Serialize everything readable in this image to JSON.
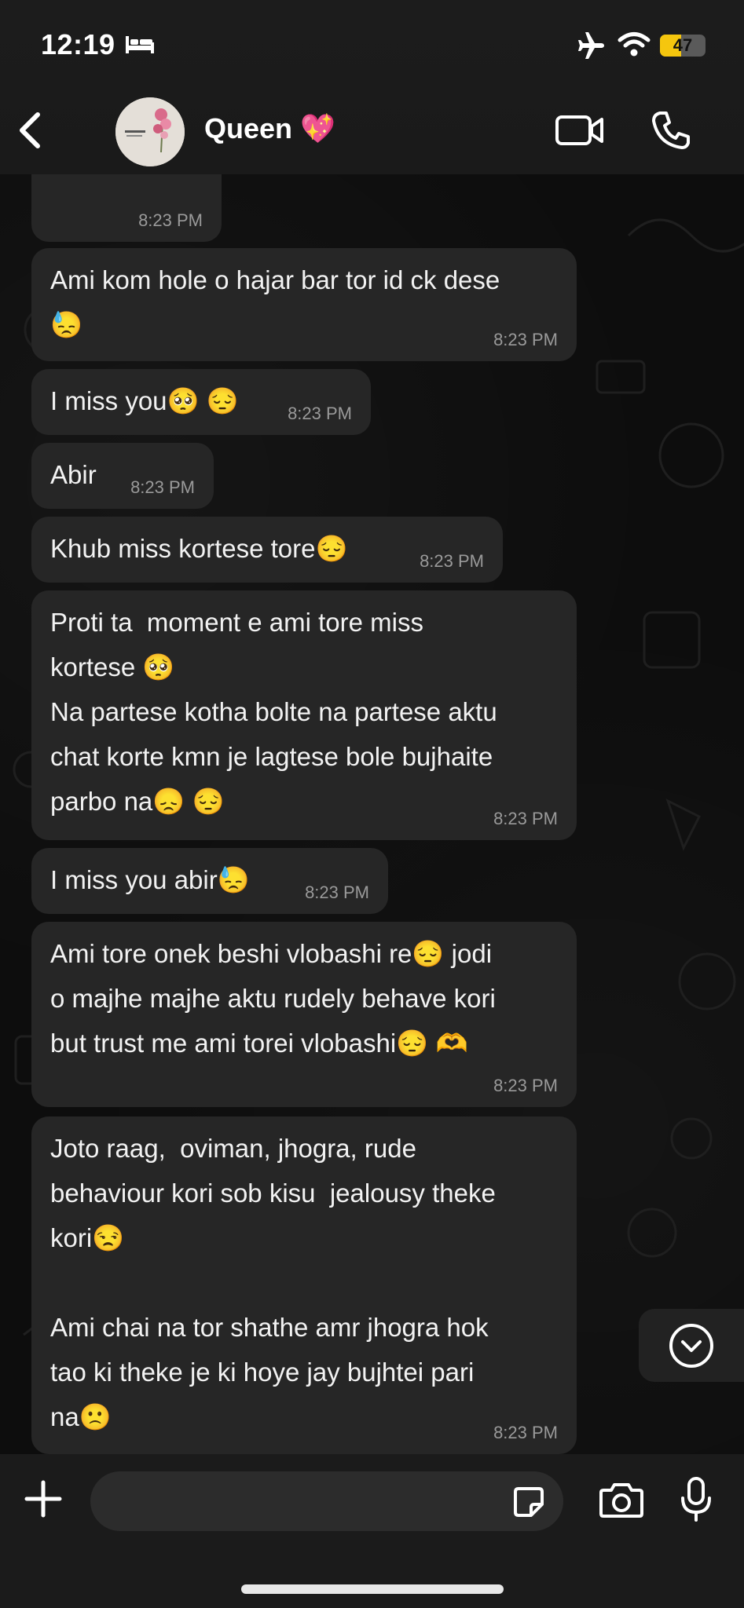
{
  "status_bar": {
    "time": "12:19",
    "battery": "47",
    "battery_level": 0.47
  },
  "header": {
    "contact_name": "Queen 💖"
  },
  "messages": [
    {
      "text": "",
      "time": "8:23 PM"
    },
    {
      "text": "Ami kom hole o hajar bar tor id ck dese\n😓",
      "time": "8:23 PM"
    },
    {
      "text": "I miss you🥺 😔",
      "time": "8:23 PM"
    },
    {
      "text": "Abir",
      "time": "8:23 PM"
    },
    {
      "text": "Khub miss kortese tore😔",
      "time": "8:23 PM"
    },
    {
      "text": "Proti ta  moment e ami tore miss\nkortese 🥺\nNa partese kotha bolte na partese aktu\nchat korte kmn je lagtese bole bujhaite\nparbo na😞 😔",
      "time": "8:23 PM"
    },
    {
      "text": "I miss you abir😓",
      "time": "8:23 PM"
    },
    {
      "text": "Ami tore onek beshi vlobashi re😔 jodi\no majhe majhe aktu rudely behave kori\nbut trust me ami torei vlobashi😔 🫶",
      "time": "8:23 PM"
    },
    {
      "text": "Joto raag,  oviman, jhogra, rude\nbehaviour kori sob kisu  jealousy theke\nkori😒\n\nAmi chai na tor shathe amr jhogra hok\ntao ki theke je ki hoye jay bujhtei pari\nna🙁",
      "time": "8:23 PM"
    }
  ],
  "icons": {
    "back": "chevron-left-icon",
    "video": "video-camera-icon",
    "phone": "phone-icon",
    "plus": "plus-icon",
    "sticker": "sticker-icon",
    "camera": "camera-icon",
    "mic": "microphone-icon",
    "scroll": "chevron-down-circle-icon"
  },
  "colors": {
    "bubble": "#262626",
    "background": "#0d0d0d",
    "battery": "#f5c60e"
  }
}
